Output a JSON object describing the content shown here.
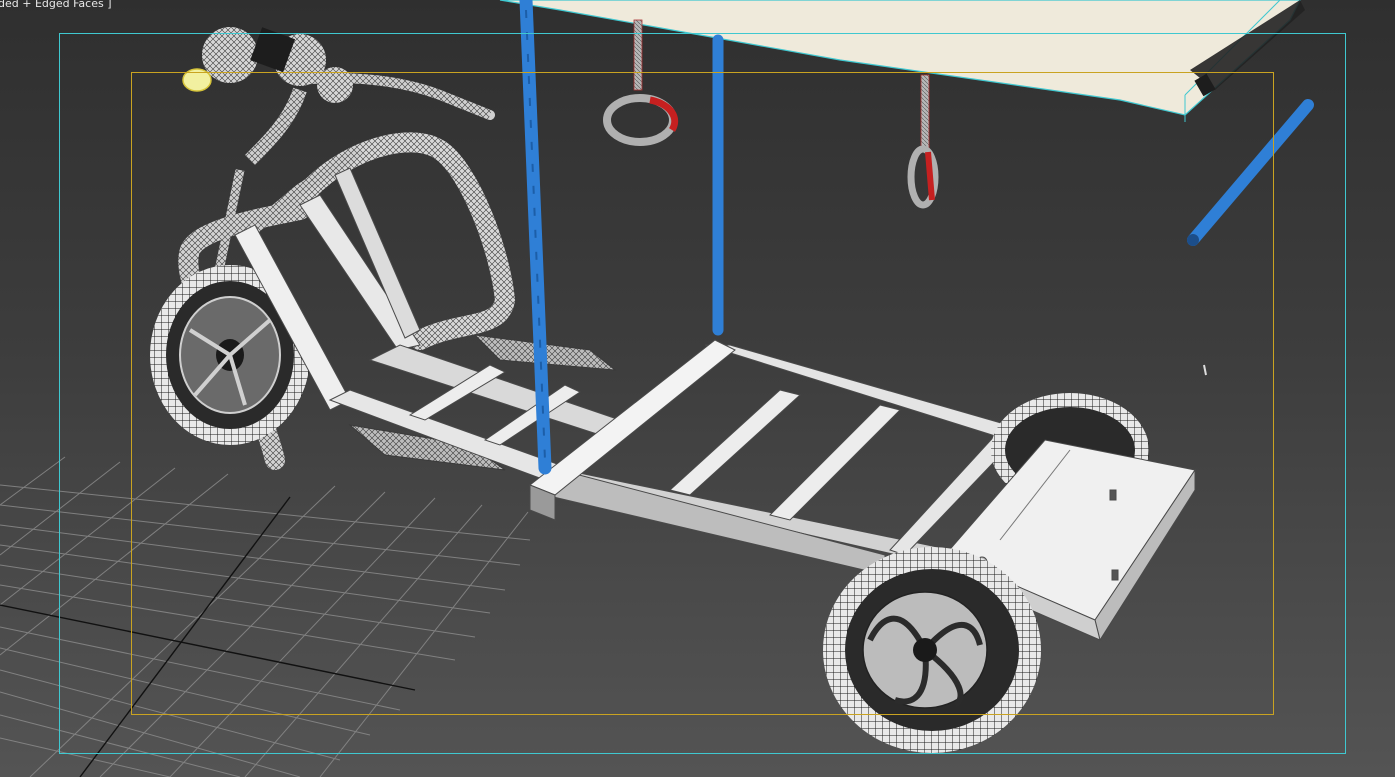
{
  "viewport": {
    "label": "ded + Edged Faces ]",
    "colors": {
      "background_top": "#2f2f2f",
      "background_bottom": "#545454",
      "safe_frame": "#3fc8d0",
      "render_frame": "#c9a321",
      "grid": "#8a8a8a",
      "grid_axis": "#111111",
      "wire_mesh": "#e6e6e6",
      "blue_pole": "#2f7fd6",
      "red_handle": "#c62020",
      "canopy": "#efeadb",
      "selection_cyan": "#3fc8d0"
    }
  },
  "scene": {
    "objects": [
      {
        "name": "scooter-frame",
        "icon": "wireframe-mesh"
      },
      {
        "name": "chassis",
        "icon": "wireframe-mesh"
      },
      {
        "name": "front-wheel",
        "icon": "tire-mesh"
      },
      {
        "name": "rear-wheel",
        "icon": "tire-mesh"
      },
      {
        "name": "back-wheel",
        "icon": "tire-mesh"
      },
      {
        "name": "pole-left",
        "icon": "cylinder"
      },
      {
        "name": "pole-right",
        "icon": "cylinder"
      },
      {
        "name": "pole-detached",
        "icon": "cylinder"
      },
      {
        "name": "hand-ring-left",
        "icon": "torus"
      },
      {
        "name": "hand-ring-right",
        "icon": "torus"
      },
      {
        "name": "canopy-roof",
        "icon": "box"
      },
      {
        "name": "home-grid",
        "icon": "grid"
      }
    ]
  }
}
